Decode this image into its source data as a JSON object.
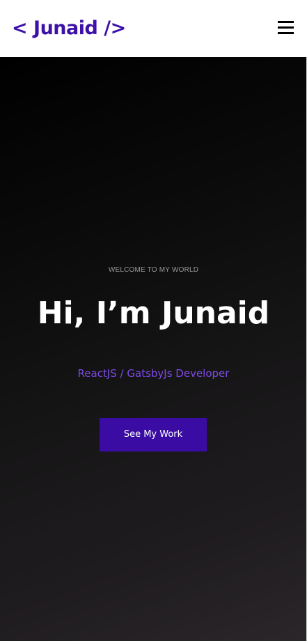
{
  "header": {
    "logo_text": "< Junaid />",
    "menu_icon": "hamburger-menu-icon"
  },
  "hero": {
    "eyebrow": "WELCOME TO MY WORLD",
    "headline": "Hi, I’m Junaid",
    "subtitle": "ReactJS / GatsbyJs Developer",
    "cta_label": "See My Work"
  },
  "colors": {
    "brand": "#3a0ca3",
    "accent": "#7d4be6",
    "hero_bg": "#000000",
    "text_light": "#ffffff"
  }
}
